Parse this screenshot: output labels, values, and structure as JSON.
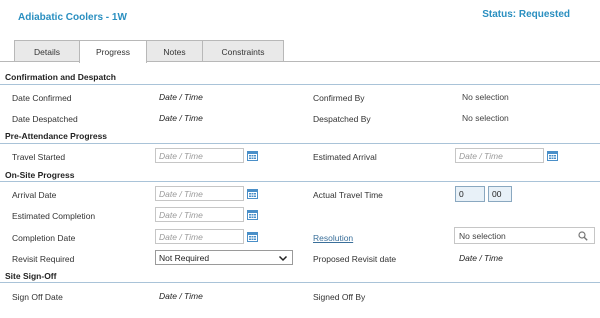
{
  "header": {
    "title": "Adiabatic Coolers - 1W",
    "status": "Status: Requested"
  },
  "tabs": [
    {
      "label": "Details"
    },
    {
      "label": "Progress"
    },
    {
      "label": "Notes"
    },
    {
      "label": "Constraints"
    }
  ],
  "sections": {
    "confirmation": "Confirmation and Despatch",
    "pre_attendance": "Pre-Attendance Progress",
    "on_site": "On-Site Progress",
    "sign_off": "Site Sign-Off"
  },
  "confirmation": {
    "date_confirmed_label": "Date Confirmed",
    "date_confirmed_value": "Date / Time",
    "confirmed_by_label": "Confirmed By",
    "confirmed_by_value": "No selection",
    "date_despatched_label": "Date Despatched",
    "date_despatched_value": "Date / Time",
    "despatched_by_label": "Despatched By",
    "despatched_by_value": "No selection"
  },
  "pre_attendance": {
    "travel_started_label": "Travel Started",
    "travel_started_placeholder": "Date / Time",
    "estimated_arrival_label": "Estimated Arrival",
    "estimated_arrival_placeholder": "Date / Time"
  },
  "on_site": {
    "arrival_date_label": "Arrival Date",
    "arrival_date_placeholder": "Date / Time",
    "actual_travel_time_label": "Actual Travel Time",
    "travel_hours": "0",
    "travel_minutes": "00",
    "estimated_completion_label": "Estimated Completion",
    "estimated_completion_placeholder": "Date / Time",
    "completion_date_label": "Completion Date",
    "completion_date_placeholder": "Date / Time",
    "resolution_label": "Resolution",
    "resolution_value": "No selection",
    "revisit_required_label": "Revisit Required",
    "revisit_required_value": "Not Required",
    "proposed_revisit_label": "Proposed Revisit date",
    "proposed_revisit_value": "Date / Time"
  },
  "sign_off": {
    "sign_off_date_label": "Sign Off Date",
    "sign_off_date_value": "Date / Time",
    "signed_off_by_label": "Signed Off By"
  },
  "colors": {
    "accent": "#2a8fc0",
    "separator": "#a9c3d8",
    "calendar_icon": "#4a8fc8"
  }
}
